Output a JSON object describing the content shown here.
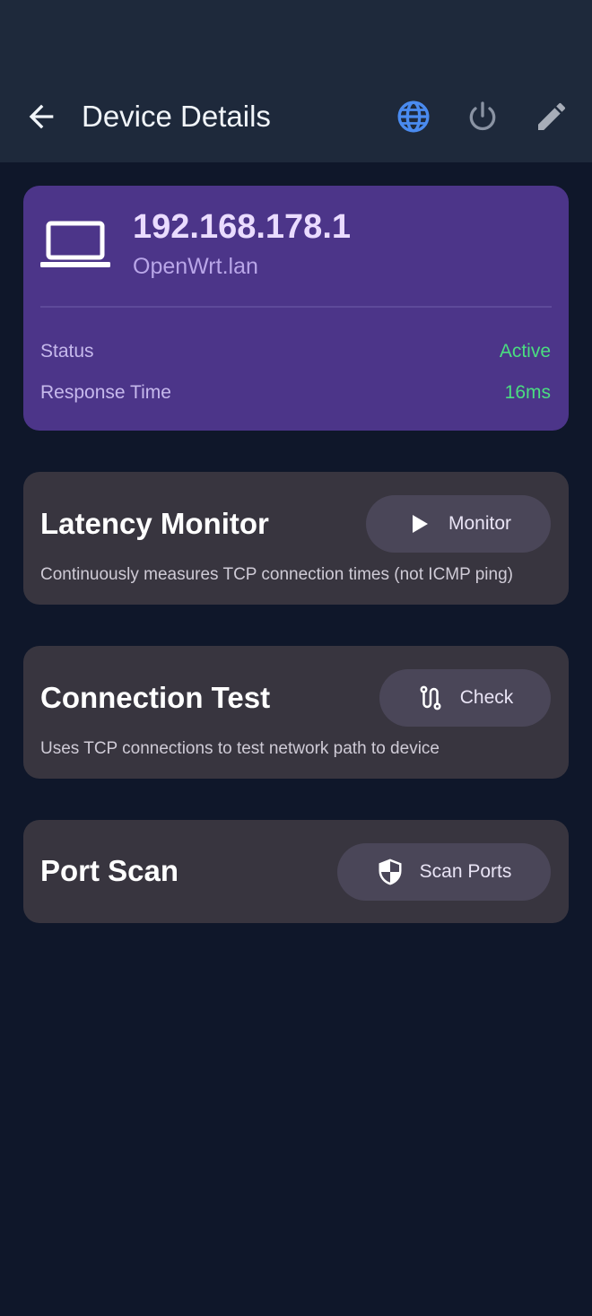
{
  "appbar": {
    "title": "Device Details",
    "icons": [
      "arrow-back-icon",
      "globe-icon",
      "power-icon",
      "edit-icon"
    ],
    "accent_color": "#4a8bf0"
  },
  "device": {
    "ip": "192.168.178.1",
    "hostname": "OpenWrt.lan",
    "icon": "laptop-icon",
    "rows": [
      {
        "label": "Status",
        "value": "Active"
      },
      {
        "label": "Response Time",
        "value": "16ms"
      }
    ],
    "value_color": "#4ade80"
  },
  "tools": {
    "latency": {
      "title": "Latency Monitor",
      "button": "Monitor",
      "icon": "play-icon",
      "description": "Continuously measures TCP connection times (not ICMP ping)"
    },
    "connection": {
      "title": "Connection Test",
      "button": "Check",
      "icon": "route-icon",
      "description": "Uses TCP connections to test network path to device"
    },
    "ports": {
      "title": "Port Scan",
      "button": "Scan Ports",
      "icon": "shield-icon"
    }
  }
}
